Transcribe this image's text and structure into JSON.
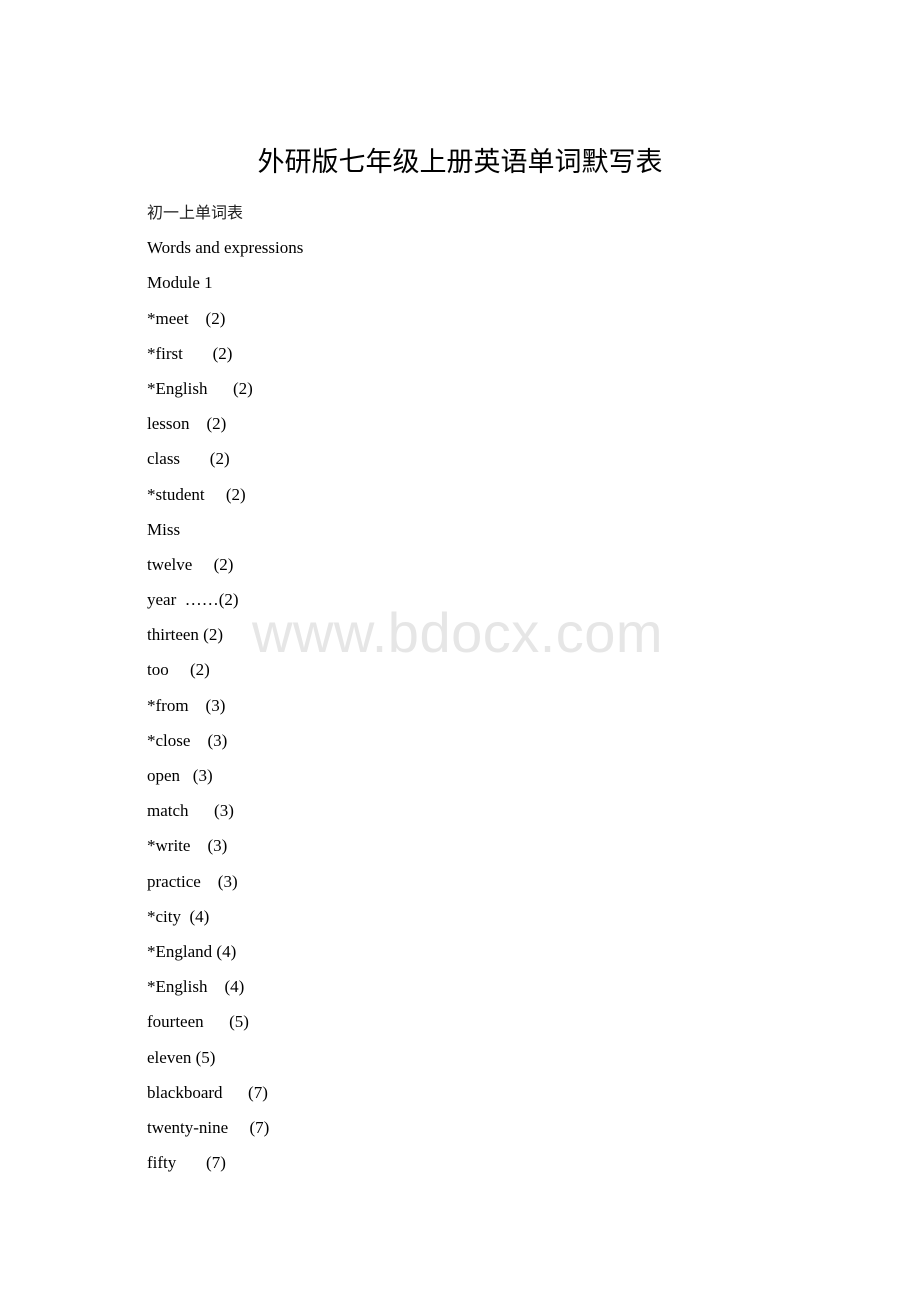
{
  "document": {
    "title": "外研版七年级上册英语单词默写表",
    "subtitle": "初一上单词表",
    "section_heading": "Words and expressions",
    "module_heading": "Module 1",
    "watermark": "www.bdocx.com",
    "entries": [
      {
        "word": "*meet",
        "gap": "    ",
        "ref": "(2)"
      },
      {
        "word": "*first",
        "gap": "       ",
        "ref": "(2)"
      },
      {
        "word": "*English",
        "gap": "      ",
        "ref": "(2)"
      },
      {
        "word": "lesson",
        "gap": "    ",
        "ref": "(2)"
      },
      {
        "word": "class",
        "gap": "       ",
        "ref": "(2)"
      },
      {
        "word": "*student",
        "gap": "     ",
        "ref": "(2)"
      },
      {
        "word": "Miss",
        "gap": "",
        "ref": ""
      },
      {
        "word": "twelve",
        "gap": "     ",
        "ref": "(2)"
      },
      {
        "word": "year",
        "gap": "  ",
        "ref": "……(2)"
      },
      {
        "word": "thirteen",
        "gap": " ",
        "ref": "(2)"
      },
      {
        "word": "too",
        "gap": "     ",
        "ref": "(2)"
      },
      {
        "word": "*from",
        "gap": "    ",
        "ref": "(3)"
      },
      {
        "word": "*close",
        "gap": "    ",
        "ref": "(3)"
      },
      {
        "word": "open",
        "gap": "   ",
        "ref": "(3)"
      },
      {
        "word": "match",
        "gap": "      ",
        "ref": "(3)"
      },
      {
        "word": "*write",
        "gap": "    ",
        "ref": "(3)"
      },
      {
        "word": "practice",
        "gap": "    ",
        "ref": "(3)"
      },
      {
        "word": "*city",
        "gap": "  ",
        "ref": "(4)"
      },
      {
        "word": "*England",
        "gap": " ",
        "ref": "(4)"
      },
      {
        "word": "*English",
        "gap": "    ",
        "ref": "(4)"
      },
      {
        "word": "fourteen",
        "gap": "      ",
        "ref": "(5)"
      },
      {
        "word": "eleven",
        "gap": " ",
        "ref": "(5)"
      },
      {
        "word": "blackboard",
        "gap": "      ",
        "ref": "(7)"
      },
      {
        "word": "twenty-nine",
        "gap": "     ",
        "ref": "(7)"
      },
      {
        "word": "fifty",
        "gap": "       ",
        "ref": "(7)"
      }
    ]
  }
}
